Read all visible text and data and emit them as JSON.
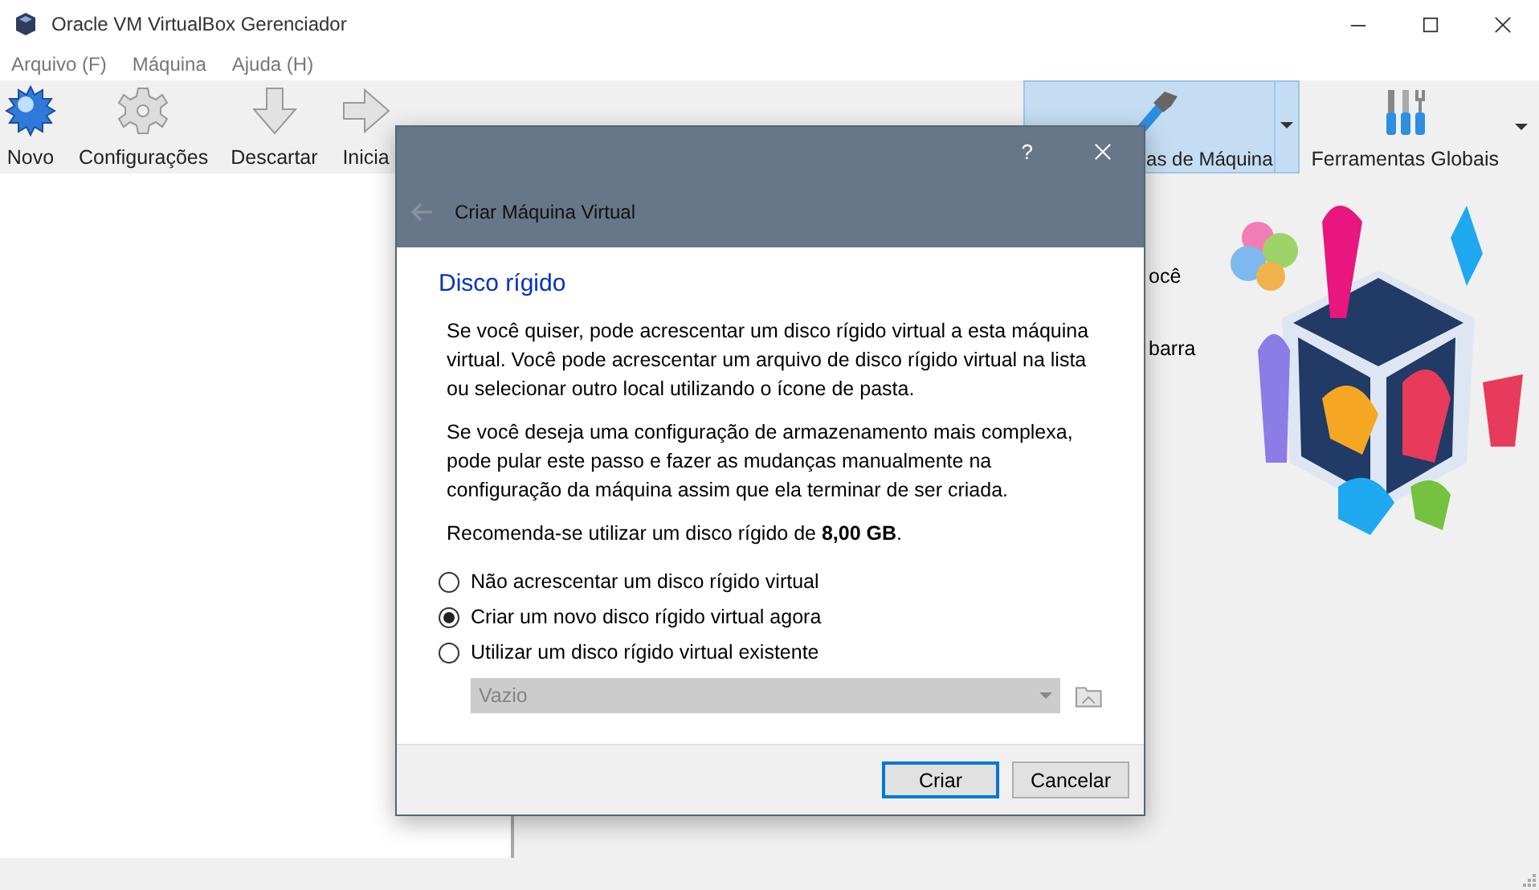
{
  "window": {
    "title": "Oracle VM VirtualBox Gerenciador"
  },
  "menu": [
    "Arquivo (F)",
    "Máquina",
    "Ajuda (H)"
  ],
  "toolbar": [
    {
      "kind": "star",
      "label": "Novo"
    },
    {
      "kind": "gear",
      "label": "Configurações"
    },
    {
      "kind": "down",
      "label": "Descartar"
    },
    {
      "kind": "right",
      "label": "Inicia"
    }
  ],
  "tools": [
    {
      "kind": "hammer",
      "label": "as de Máquina",
      "selected": true
    },
    {
      "kind": "screwdrivers",
      "label": "Ferramentas Globais",
      "selected": false
    }
  ],
  "details_text": [
    "ocê",
    "barra"
  ],
  "dialog": {
    "help": "?",
    "title": "Criar Máquina Virtual",
    "heading": "Disco rígido",
    "paragraphs": [
      "Se você quiser, pode acrescentar um disco rígido virtual a esta máquina virtual. Você pode acrescentar um arquivo de disco rígido virtual na lista ou selecionar outro local utilizando o ícone de pasta.",
      "Se você deseja uma configuração de armazenamento mais complexa, pode pular este passo e fazer as mudanças manualmente na configuração da máquina assim que ela terminar de ser criada.",
      "Recomenda-se utilizar um disco rígido de **8,00 GB**."
    ],
    "options": [
      {
        "label": "Não acrescentar um disco rígido virtual",
        "selected": false
      },
      {
        "label": "Criar um novo disco rígido virtual agora",
        "selected": true
      },
      {
        "label": "Utilizar um disco rígido virtual existente",
        "selected": false
      }
    ],
    "combo": {
      "value": "Vazio",
      "disabled": true
    },
    "buttons": [
      {
        "label": "Criar",
        "default": true
      },
      {
        "label": "Cancelar",
        "default": false
      }
    ]
  }
}
